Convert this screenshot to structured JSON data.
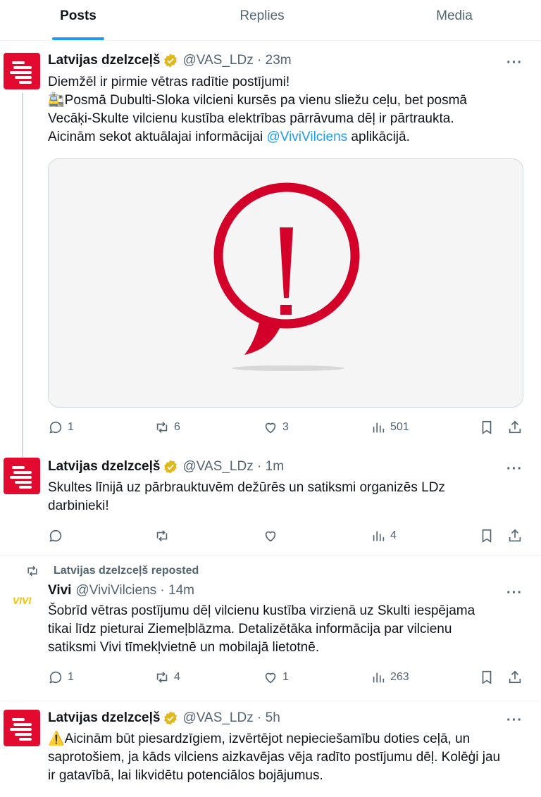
{
  "tabs": [
    {
      "label": "Posts",
      "active": true
    },
    {
      "label": "Replies",
      "active": false
    },
    {
      "label": "Media",
      "active": false
    }
  ],
  "posts": [
    {
      "author": "Latvijas dzelzceļš",
      "handle": "@VAS_LDz",
      "time": "23m",
      "lines": [
        "Diemžēl ir pirmie vētras radītie postījumi!",
        "🚉Posmā Dubulti-Sloka vilcieni kursēs pa vienu sliežu ceļu, bet posmā",
        "Vecāķi-Skulte vilcienu kustība elektrības pārrāvuma dēļ ir pārtraukta.",
        "Aicinām sekot aktuālajai informācijai "
      ],
      "mention": "@ViviVilciens",
      "after_mention": "  aplikācijā.",
      "stats": {
        "replies": "1",
        "reposts": "6",
        "likes": "3",
        "views": "501"
      }
    },
    {
      "author": "Latvijas dzelzceļš",
      "handle": "@VAS_LDz",
      "time": "1m",
      "lines": [
        "Skultes līnijā uz pārbrauktuvēm dežūrēs un satiksmi organizēs LDz",
        "darbinieki!"
      ],
      "stats": {
        "replies": "",
        "reposts": "",
        "likes": "",
        "views": "4"
      }
    },
    {
      "repost_label": "Latvijas dzelzceļš reposted",
      "author": "Vivi",
      "handle": "@ViviVilciens",
      "time": "14m",
      "logo_text": "VIVI",
      "lines": [
        "Šobrīd vētras postījumu dēļ vilcienu kustība virzienā uz Skulti iespējama",
        "tikai līdz pieturai Ziemeļblāzma. Detalizētāka informācija par vilcienu",
        "satiksmi Vivi tīmekļvietnē un mobilajā lietotnē."
      ],
      "stats": {
        "replies": "1",
        "reposts": "4",
        "likes": "1",
        "views": "263"
      }
    },
    {
      "author": "Latvijas dzelzceļš",
      "handle": "@VAS_LDz",
      "time": "5h",
      "lines": [
        "⚠️Aicinām būt piesardzīgiem, izvērtējot nepieciešamību doties ceļā, un",
        "saprotošiem, ja kāds vilciens aizkavējas vēja radīto postījumu dēļ. Kolēģi jau",
        "ir gatavībā, lai likvidētu potenciālos bojājumus."
      ]
    }
  ],
  "colors": {
    "brand_red": "#e30a2f",
    "link_blue": "#1d9bf0",
    "muted": "#536471",
    "verified_gold": "#e2b719",
    "vivi_yellow": "#f5c400"
  },
  "icons": [
    "reply-icon",
    "repost-icon",
    "like-icon",
    "views-icon",
    "bookmark-icon",
    "share-icon",
    "verified-badge-icon",
    "more-icon",
    "alert-speech-bubble-icon"
  ]
}
